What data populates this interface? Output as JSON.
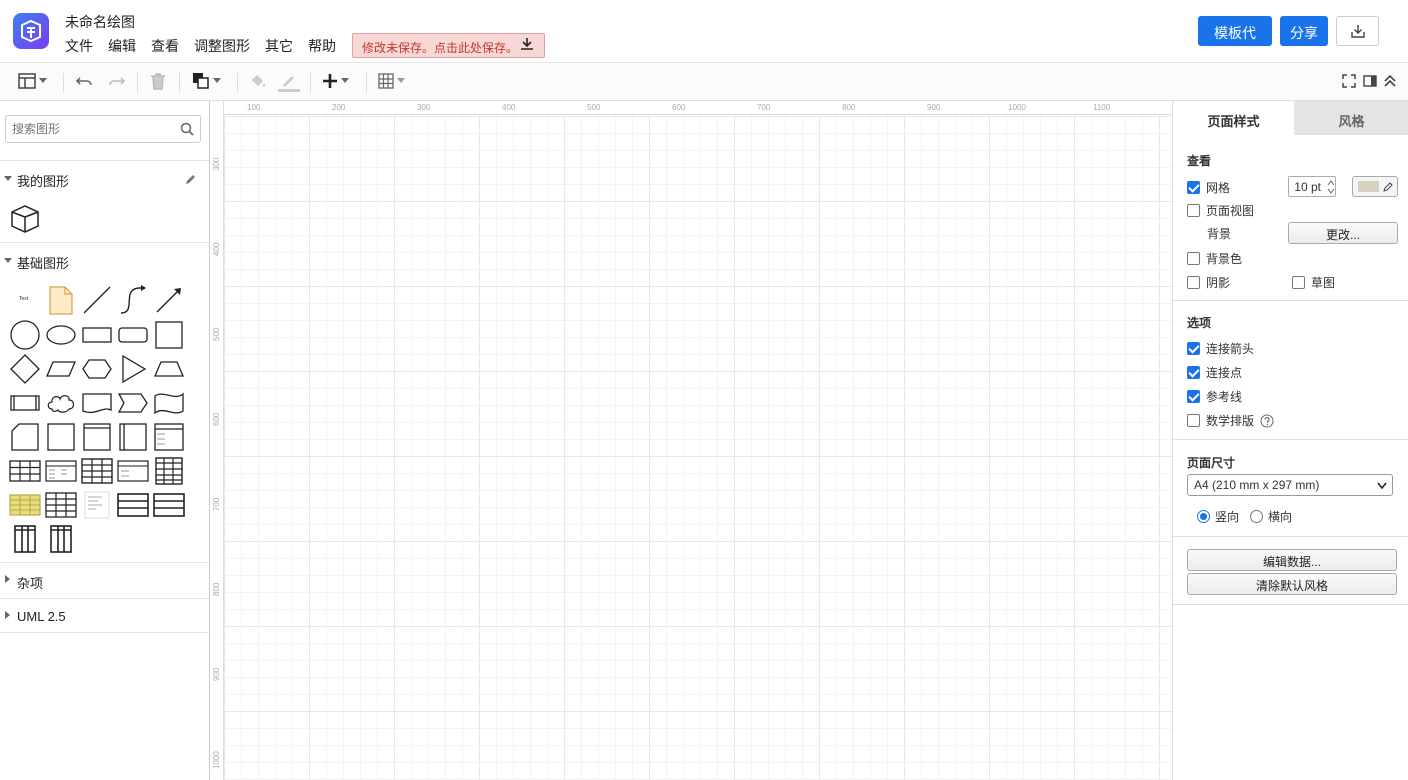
{
  "app": {
    "title": "未命名绘图"
  },
  "menu": [
    "文件",
    "编辑",
    "查看",
    "调整图形",
    "其它",
    "帮助"
  ],
  "unsaved_notice": "修改未保存。点击此处保存。",
  "header_buttons": {
    "template_code": "模板代码",
    "share": "分享"
  },
  "search": {
    "placeholder": "搜索图形"
  },
  "sidebar": {
    "my_shapes": "我的图形",
    "basic_shapes": "基础图形",
    "misc": "杂项",
    "uml": "UML 2.5",
    "text_shape_label": "Text"
  },
  "ruler": {
    "top": [
      "100",
      "200",
      "300",
      "400",
      "500",
      "600",
      "700",
      "800",
      "900",
      "1000",
      "1100"
    ],
    "left": [
      "300",
      "400",
      "500",
      "600",
      "700",
      "800",
      "900",
      "1000"
    ]
  },
  "panel": {
    "tabs": [
      "页面样式",
      "风格"
    ],
    "view": {
      "title": "查看",
      "grid": {
        "label": "网格",
        "checked": true,
        "size": "10 pt"
      },
      "page_view": {
        "label": "页面视图",
        "checked": false
      },
      "background": {
        "label": "背景",
        "button": "更改..."
      },
      "background_color": {
        "label": "背景色",
        "checked": false
      },
      "shadow": {
        "label": "阴影",
        "checked": false
      },
      "sketch": {
        "label": "草图",
        "checked": false
      }
    },
    "options": {
      "title": "选项",
      "connection_arrows": {
        "label": "连接箭头",
        "checked": true
      },
      "connection_points": {
        "label": "连接点",
        "checked": true
      },
      "guides": {
        "label": "参考线",
        "checked": true
      },
      "math": {
        "label": "数学排版",
        "checked": false
      }
    },
    "page_size": {
      "title": "页面尺寸",
      "selected": "A4 (210 mm x 297 mm)",
      "portrait": "竖向",
      "landscape": "横向",
      "orientation": "portrait"
    },
    "actions": {
      "edit_data": "编辑数据...",
      "clear_style": "清除默认风格"
    }
  },
  "colors": {
    "accent": "#1a73e8",
    "grid_swatch": "#d8d0c0",
    "note_fill": "#fdebc8",
    "table_gold": "#b8a840"
  }
}
